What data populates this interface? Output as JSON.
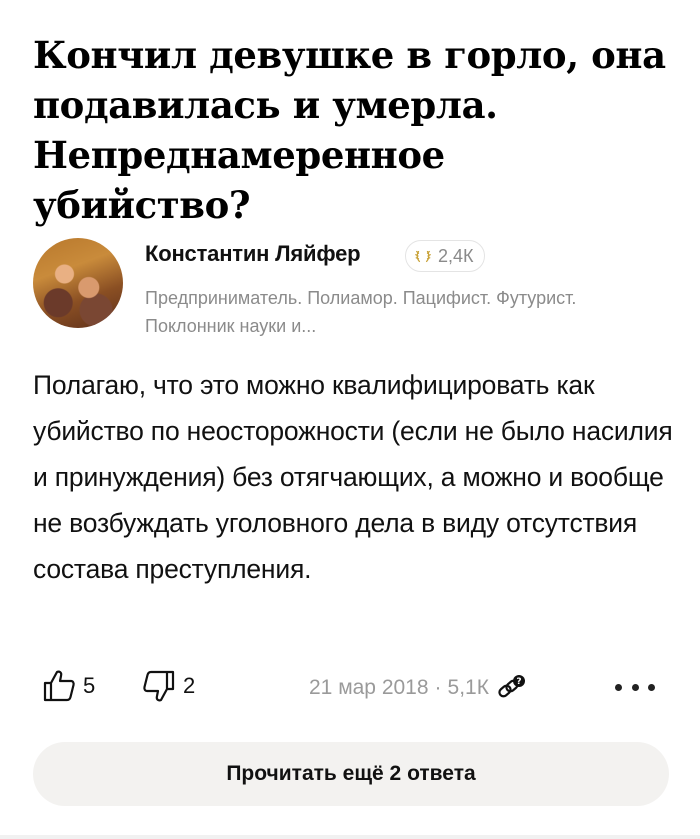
{
  "question": {
    "title": "Кончил девушке в горло, она подавилась и умерла. Непреднамеренное убийство?"
  },
  "author": {
    "name": "Константин Ляйфер",
    "karma": "2,4К",
    "bio": "Предприниматель. Полиамор. Пацифист. Футурист. Поклонник науки и..."
  },
  "answer": {
    "text": "Полагаю, что это можно квалифицировать как убийство по неосторожности (если не было насилия и принуждения) без отягчающих, а можно и вообще не возбуждать уголовного дела в виду отсутствия состава преступления."
  },
  "actions": {
    "upvotes": "5",
    "downvotes": "2",
    "date": "21 мар 2018",
    "separator": "·",
    "views": "5,1К"
  },
  "read_more_label": "Прочитать ещё 2 ответа",
  "icons": {
    "karma": "laurel-icon",
    "upvote": "thumbs-up-icon",
    "downvote": "thumbs-down-icon",
    "views": "link-question-icon",
    "more": "more-dots-icon"
  },
  "colors": {
    "text": "#111111",
    "muted": "#8b8b8b",
    "button_bg": "#f3f2f0"
  }
}
